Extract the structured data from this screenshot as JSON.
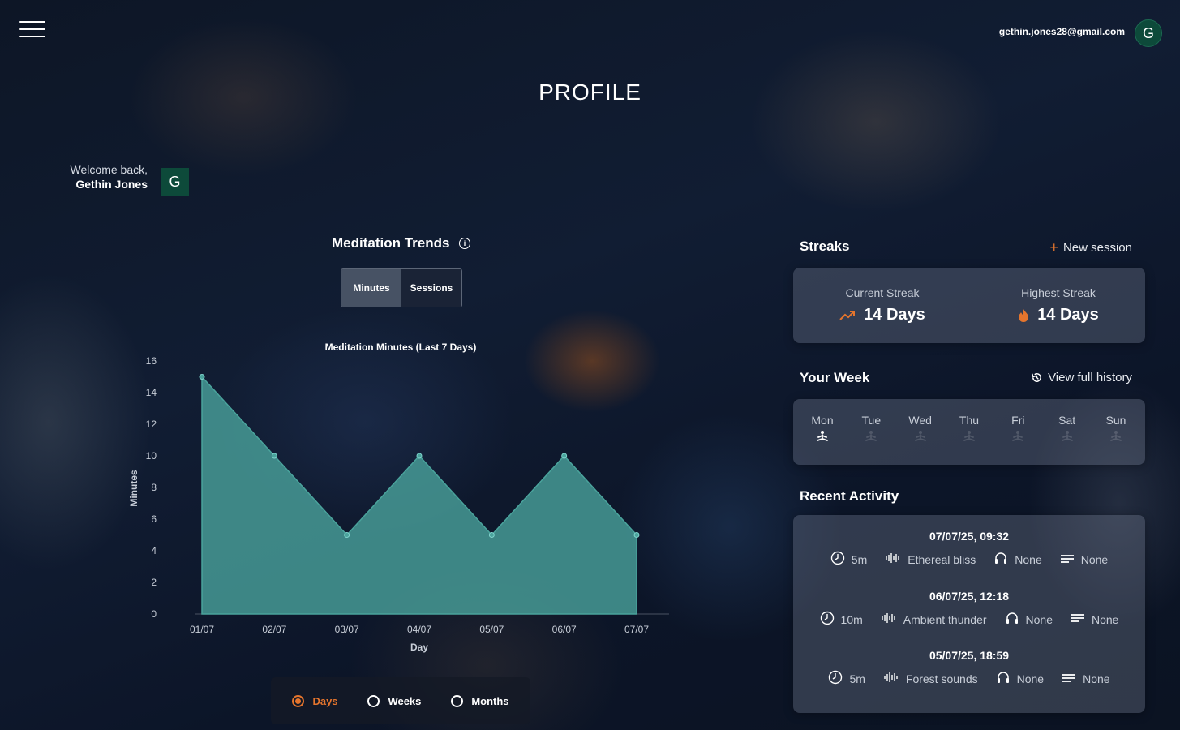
{
  "header": {
    "user_email": "gethin.jones28@gmail.com",
    "avatar_initial": "G",
    "page_title": "PROFILE"
  },
  "welcome": {
    "greeting": "Welcome back,",
    "name": "Gethin Jones",
    "avatar_initial": "G"
  },
  "trends": {
    "title": "Meditation Trends",
    "toggle": {
      "minutes_label": "Minutes",
      "sessions_label": "Sessions",
      "selected": "Minutes"
    },
    "range_options": [
      {
        "label": "Days",
        "selected": true
      },
      {
        "label": "Weeks",
        "selected": false
      },
      {
        "label": "Months",
        "selected": false
      }
    ]
  },
  "chart_data": {
    "type": "area",
    "title": "Meditation Minutes (Last 7 Days)",
    "xlabel": "Day",
    "ylabel": "Minutes",
    "categories": [
      "01/07",
      "02/07",
      "03/07",
      "04/07",
      "05/07",
      "06/07",
      "07/07"
    ],
    "values": [
      15,
      10,
      5,
      10,
      5,
      10,
      5
    ],
    "ylim": [
      0,
      16
    ],
    "yticks": [
      0,
      2,
      4,
      6,
      8,
      10,
      12,
      14,
      16
    ],
    "color": "#4aa39c",
    "grid": false
  },
  "streaks": {
    "title": "Streaks",
    "new_session_label": "New session",
    "current_label": "Current Streak",
    "current_value": "14 Days",
    "highest_label": "Highest Streak",
    "highest_value": "14 Days",
    "accent": "#e5752d"
  },
  "week": {
    "title": "Your Week",
    "history_label": "View full history",
    "days": [
      {
        "name": "Mon",
        "active": true
      },
      {
        "name": "Tue",
        "active": false
      },
      {
        "name": "Wed",
        "active": false
      },
      {
        "name": "Thu",
        "active": false
      },
      {
        "name": "Fri",
        "active": false
      },
      {
        "name": "Sat",
        "active": false
      },
      {
        "name": "Sun",
        "active": false
      }
    ]
  },
  "activity": {
    "title": "Recent Activity",
    "items": [
      {
        "datetime": "07/07/25, 09:32",
        "duration": "5m",
        "soundscape": "Ethereal bliss",
        "audio": "None",
        "guide": "None"
      },
      {
        "datetime": "06/07/25, 12:18",
        "duration": "10m",
        "soundscape": "Ambient thunder",
        "audio": "None",
        "guide": "None"
      },
      {
        "datetime": "05/07/25, 18:59",
        "duration": "5m",
        "soundscape": "Forest sounds",
        "audio": "None",
        "guide": "None"
      }
    ]
  }
}
